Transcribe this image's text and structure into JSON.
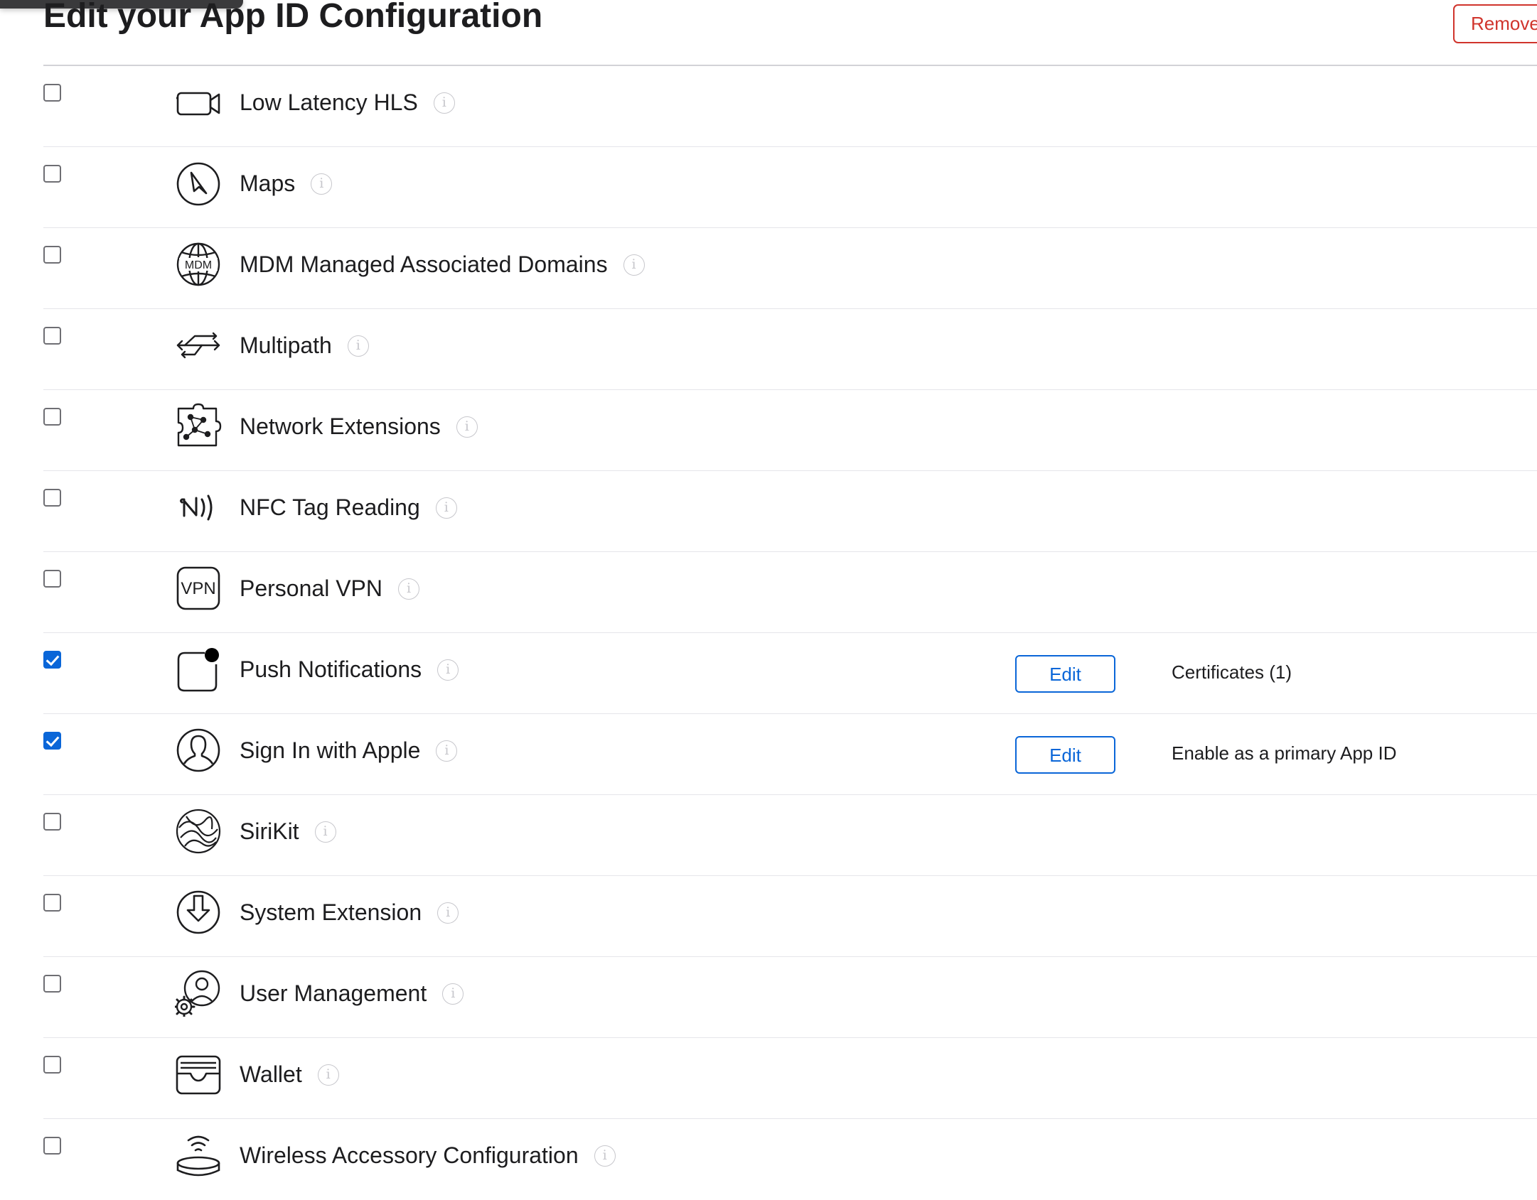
{
  "header": {
    "title": "Edit your App ID Configuration",
    "remove_label": "Remove"
  },
  "colors": {
    "accent": "#0a66d8",
    "danger": "#d0342c",
    "divider": "#e5e5ea",
    "info": "#c7c7cc"
  },
  "capabilities": [
    {
      "label": "Low Latency HLS",
      "icon": "video-camera-icon",
      "checked": false
    },
    {
      "label": "Maps",
      "icon": "compass-icon",
      "checked": false
    },
    {
      "label": "MDM Managed Associated Domains",
      "icon": "mdm-globe-icon",
      "checked": false
    },
    {
      "label": "Multipath",
      "icon": "multipath-arrows-icon",
      "checked": false
    },
    {
      "label": "Network Extensions",
      "icon": "network-extension-icon",
      "checked": false
    },
    {
      "label": "NFC Tag Reading",
      "icon": "nfc-icon",
      "checked": false
    },
    {
      "label": "Personal VPN",
      "icon": "vpn-icon",
      "checked": false,
      "icon_text": "VPN"
    },
    {
      "label": "Push Notifications",
      "icon": "notification-badge-icon",
      "checked": true,
      "edit_label": "Edit",
      "detail": "Certificates (1)"
    },
    {
      "label": "Sign In with Apple",
      "icon": "person-circle-icon",
      "checked": true,
      "edit_label": "Edit",
      "detail": "Enable as a primary App ID"
    },
    {
      "label": "SiriKit",
      "icon": "siri-icon",
      "checked": false
    },
    {
      "label": "System Extension",
      "icon": "download-arrow-icon",
      "checked": false
    },
    {
      "label": "User Management",
      "icon": "user-gear-icon",
      "checked": false
    },
    {
      "label": "Wallet",
      "icon": "wallet-icon",
      "checked": false
    },
    {
      "label": "Wireless Accessory Configuration",
      "icon": "wireless-accessory-icon",
      "checked": false
    }
  ],
  "icon_texts": {
    "mdm": "MDM",
    "vpn": "VPN"
  },
  "info_glyph": "i"
}
